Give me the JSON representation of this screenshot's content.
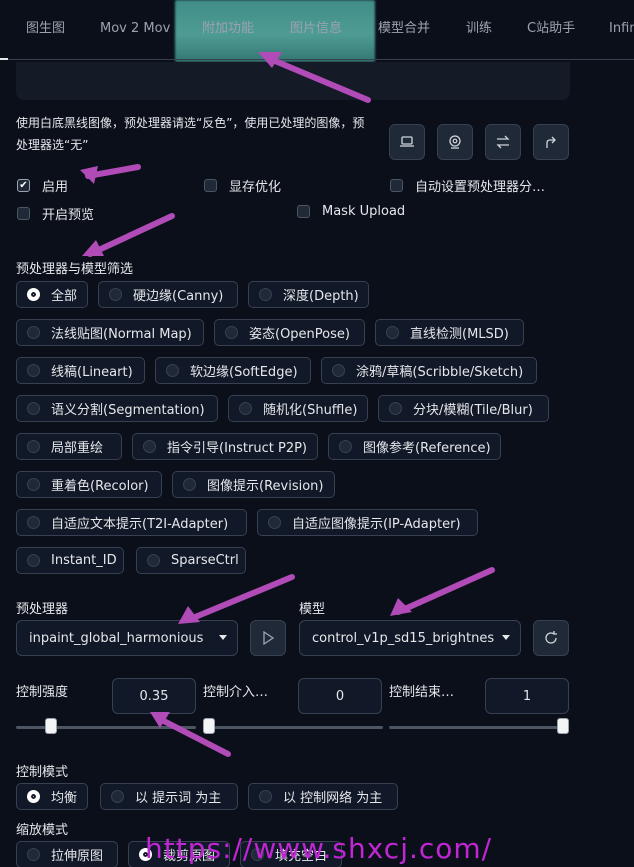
{
  "tabs": [
    "图生图",
    "Mov 2 Mov",
    "附加功能",
    "图片信息",
    "模型合并",
    "训练",
    "C站助手",
    "Infin"
  ],
  "hint": "使用白底黑线图像，预处理器请选“反色”，使用已处理的图像，预处理器选“无”",
  "options": {
    "enable": "启用",
    "lowvram": "显存优化",
    "auto_preproc": "自动设置预处理器分…",
    "preview": "开启预览",
    "mask_upload": "Mask Upload"
  },
  "filter_label": "预处理器与模型筛选",
  "filters": [
    "全部",
    "硬边缘(Canny)",
    "深度(Depth)",
    "法线贴图(Normal Map)",
    "姿态(OpenPose)",
    "直线检测(MLSD)",
    "线稿(Lineart)",
    "软边缘(SoftEdge)",
    "涂鸦/草稿(Scribble/Sketch)",
    "语义分割(Segmentation)",
    "随机化(Shuffle)",
    "分块/模糊(Tile/Blur)",
    "局部重绘",
    "指令引导(Instruct P2P)",
    "图像参考(Reference)",
    "重着色(Recolor)",
    "图像提示(Revision)",
    "自适应文本提示(T2I-Adapter)",
    "自适应图像提示(IP-Adapter)",
    "Instant_ID",
    "SparseCtrl"
  ],
  "preprocessor_label": "预处理器",
  "preprocessor_value": "inpaint_global_harmonious",
  "model_label": "模型",
  "model_value": "control_v1p_sd15_brightnes",
  "weight_label": "控制强度",
  "weight_value": "0.35",
  "start_label": "控制介入…",
  "start_value": "0",
  "end_label": "控制结束…",
  "end_value": "1",
  "control_mode_label": "控制模式",
  "control_modes": [
    "均衡",
    "以 提示词 为主",
    "以 控制网络 为主"
  ],
  "resize_label": "缩放模式",
  "resize_modes": [
    "拉伸原图",
    "裁剪原图",
    "填充空白"
  ],
  "watermark": "https://www.shxcj.com/",
  "sliders": {
    "weight": 0.175,
    "start": 0.0,
    "end": 1.0
  },
  "icons": [
    "laptop-icon",
    "camera-icon",
    "swap-icon",
    "send-icon",
    "play-icon",
    "refresh-icon"
  ],
  "colors": {
    "background": "#0b0f19",
    "annotation_arrow": "#b04bb8",
    "watermark": "#c026d3"
  }
}
